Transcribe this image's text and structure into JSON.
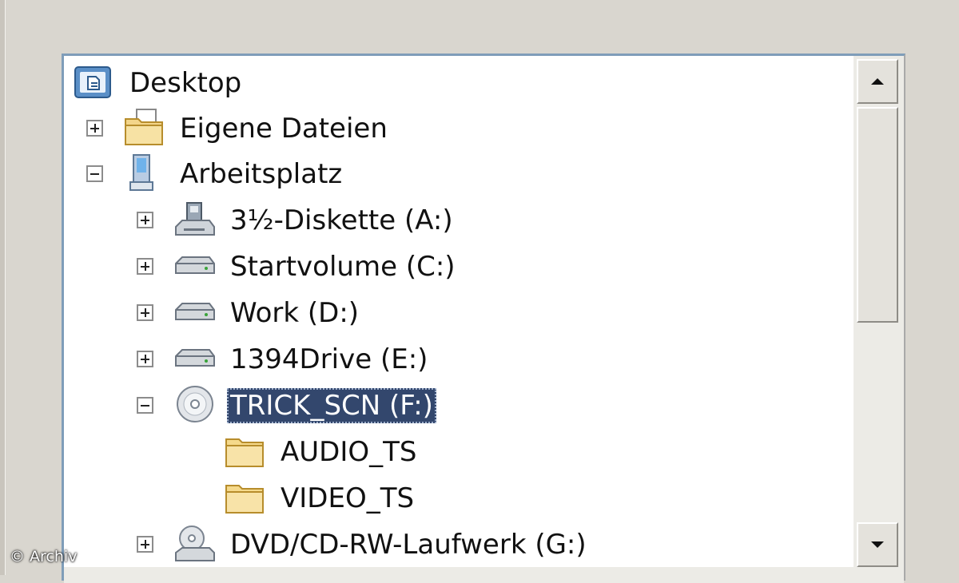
{
  "tree": {
    "items": [
      {
        "label": "Desktop",
        "icon": "desktop-icon",
        "expander": "none"
      },
      {
        "label": "Eigene Dateien",
        "icon": "my-documents-icon",
        "expander": "plus"
      },
      {
        "label": "Arbeitsplatz",
        "icon": "my-computer-icon",
        "expander": "minus"
      },
      {
        "label": "3½-Diskette (A:)",
        "icon": "floppy-drive-icon",
        "expander": "plus"
      },
      {
        "label": "Startvolume (C:)",
        "icon": "hard-drive-icon",
        "expander": "plus"
      },
      {
        "label": "Work (D:)",
        "icon": "hard-drive-icon",
        "expander": "plus"
      },
      {
        "label": "1394Drive (E:)",
        "icon": "hard-drive-icon",
        "expander": "plus"
      },
      {
        "label": "TRICK_SCN (F:)",
        "icon": "cd-drive-icon",
        "expander": "minus",
        "selected": true
      },
      {
        "label": "AUDIO_TS",
        "icon": "folder-icon",
        "expander": "none"
      },
      {
        "label": "VIDEO_TS",
        "icon": "folder-icon",
        "expander": "none"
      },
      {
        "label": "DVD/CD-RW-Laufwerk (G:)",
        "icon": "dvd-drive-icon",
        "expander": "plus"
      }
    ]
  },
  "watermark": "© Archiv",
  "colors": {
    "selection": "#33476d",
    "panel_border": "#7f9db9",
    "dialog_bg": "#d9d6cf"
  }
}
